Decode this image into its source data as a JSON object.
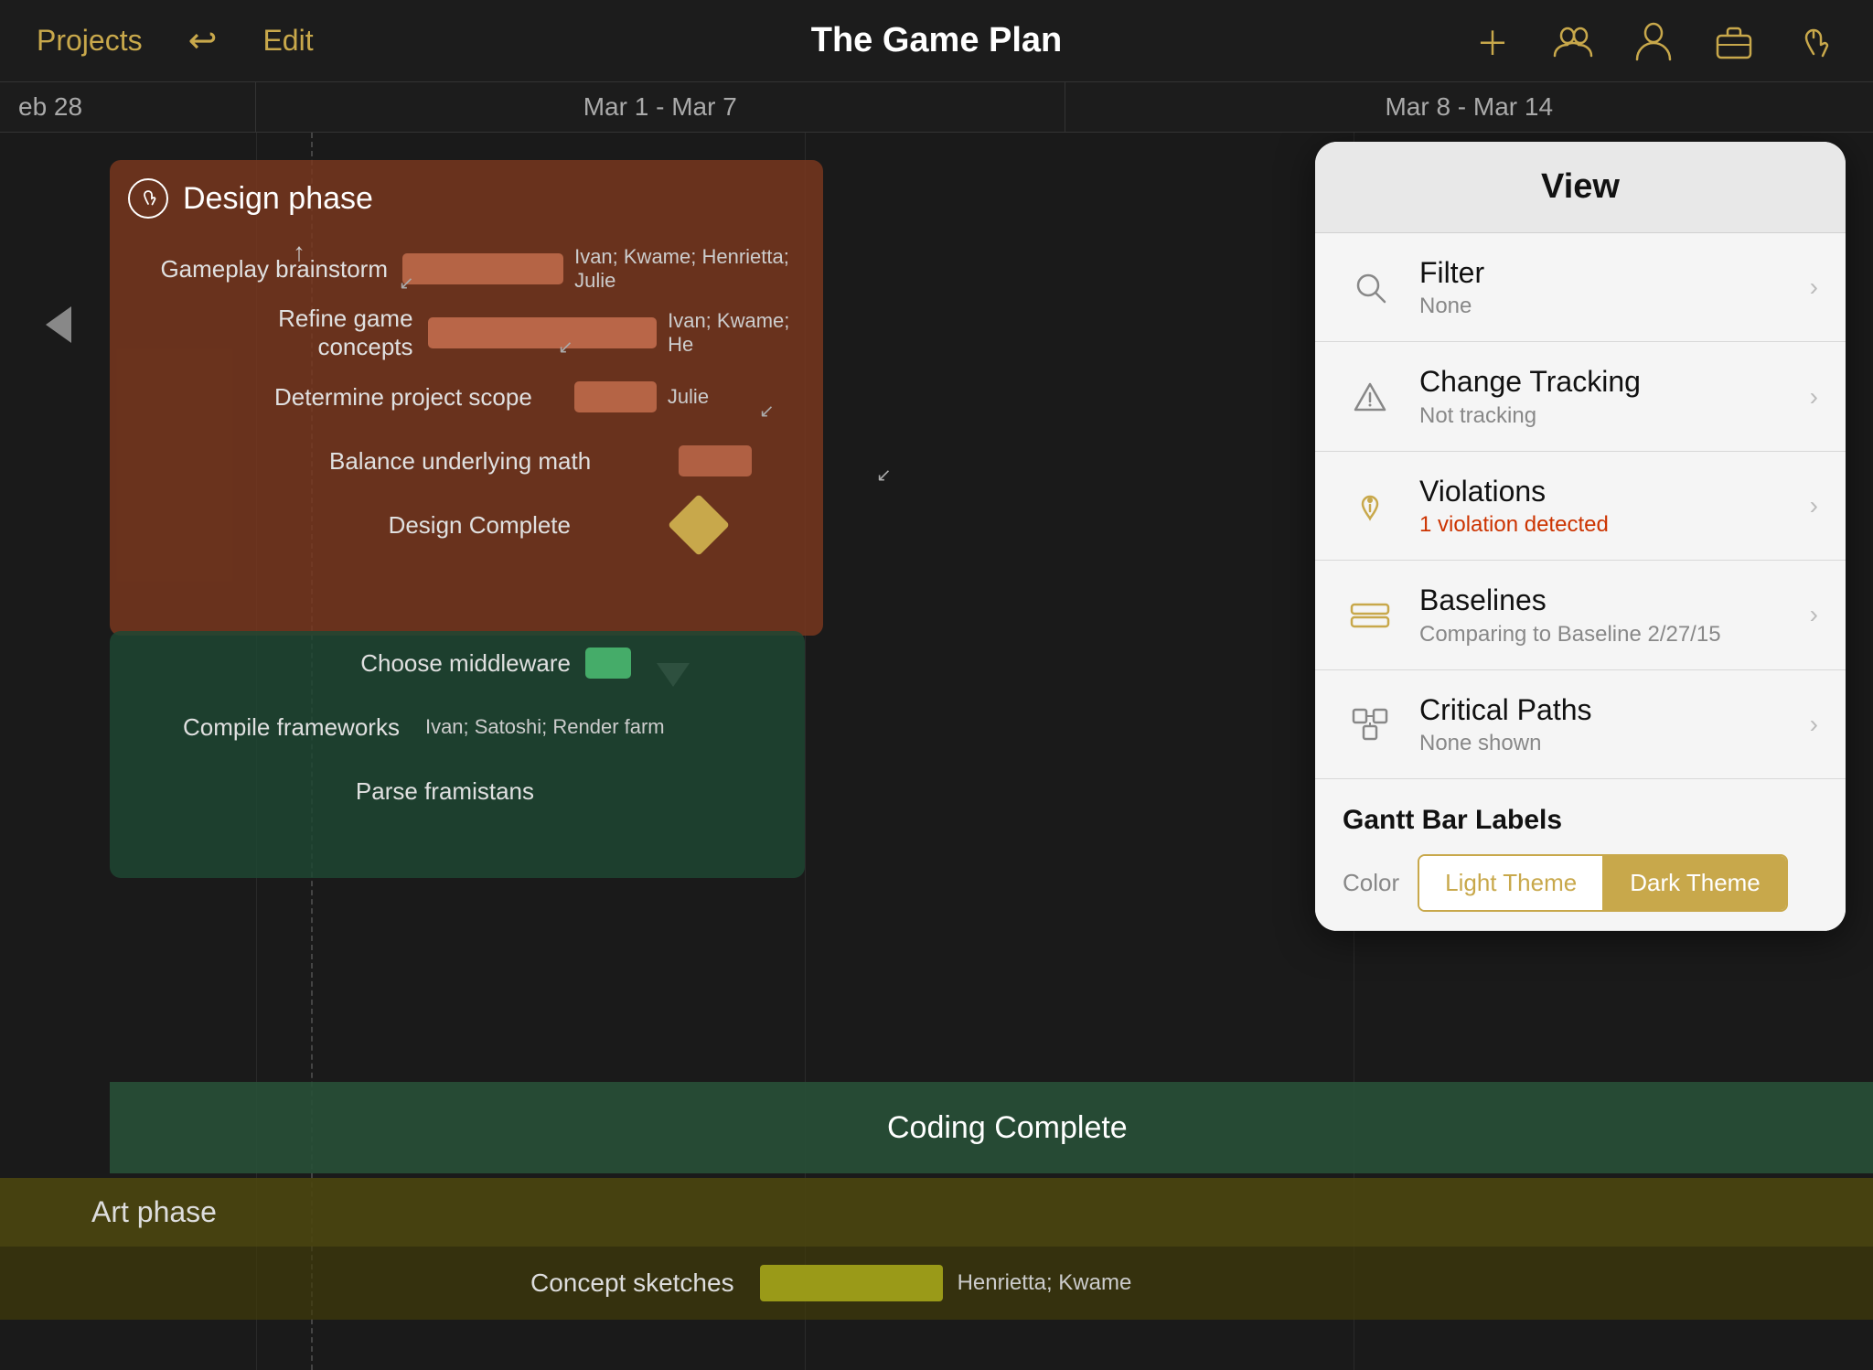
{
  "app": {
    "title": "The Game Plan",
    "nav_back": "Projects",
    "nav_edit": "Edit"
  },
  "toolbar": {
    "plus_icon": "+",
    "people_icon": "👥",
    "person_icon": "👤",
    "briefcase_icon": "💼",
    "hand_icon": "✋"
  },
  "date_header": {
    "col1": "eb 28",
    "col2": "Mar 1 - Mar 7",
    "col3": "Mar 8 - Mar 14"
  },
  "gantt": {
    "design_phase": {
      "title": "Design phase",
      "tasks": [
        {
          "label": "Gameplay brainstorm",
          "resource": "Ivan; Kwame; Henrietta; Julie"
        },
        {
          "label": "Refine game concepts",
          "resource": "Ivan; Kwame; He"
        },
        {
          "label": "Determine project scope",
          "resource": "Julie"
        },
        {
          "label": "Balance underlying math",
          "resource": ""
        },
        {
          "label": "Design Complete",
          "resource": ""
        }
      ]
    },
    "coding_section": {
      "tasks": [
        {
          "label": "Choose middleware",
          "resource": ""
        },
        {
          "label": "Compile frameworks",
          "resource": "Ivan; Satoshi; Render farm"
        },
        {
          "label": "Parse framistans",
          "resource": ""
        }
      ],
      "milestone": "Coding Complete"
    },
    "art_phase": {
      "title": "Art phase",
      "tasks": [
        {
          "label": "Concept sketches",
          "resource": "Henrietta; Kwame"
        }
      ]
    }
  },
  "view_panel": {
    "title": "View",
    "items": [
      {
        "id": "filter",
        "label": "Filter",
        "sub": "None",
        "sub_class": "",
        "icon_type": "search"
      },
      {
        "id": "change_tracking",
        "label": "Change Tracking",
        "sub": "Not tracking",
        "sub_class": "",
        "icon_type": "triangle-warning"
      },
      {
        "id": "violations",
        "label": "Violations",
        "sub": "1 violation detected",
        "sub_class": "red",
        "icon_type": "hand-orange"
      },
      {
        "id": "baselines",
        "label": "Baselines",
        "sub": "Comparing to Baseline 2/27/15",
        "sub_class": "",
        "icon_type": "baselines"
      },
      {
        "id": "critical_paths",
        "label": "Critical Paths",
        "sub": "None shown",
        "sub_class": "",
        "icon_type": "critical-paths"
      }
    ],
    "gantt_bar_labels": {
      "title": "Gantt Bar Labels",
      "color_label": "Color",
      "themes": [
        {
          "id": "light",
          "label": "Light Theme",
          "active": false
        },
        {
          "id": "dark",
          "label": "Dark Theme",
          "active": true
        }
      ]
    }
  }
}
